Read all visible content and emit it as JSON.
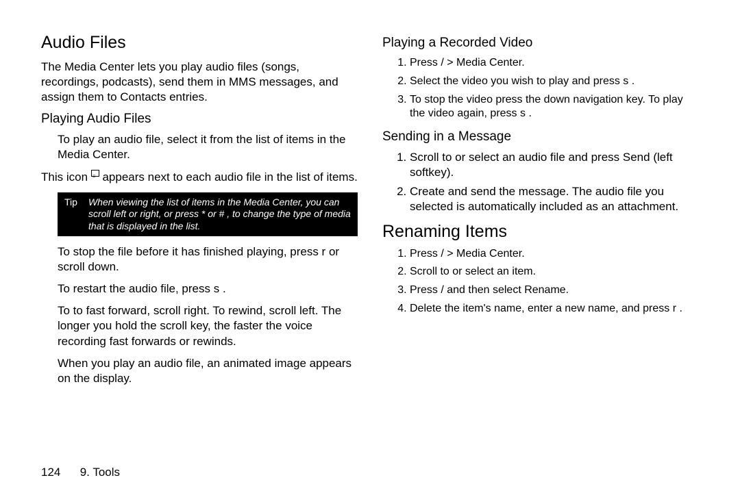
{
  "left": {
    "h1": "Audio Files",
    "intro": "The Media Center lets you play audio files (songs, recordings, podcasts), send them in MMS messages, and assign them to Contacts entries.",
    "h2": "Playing Audio Files",
    "p1": "To play an audio file, select it from the list of items in the Media Center.",
    "p2a": "This icon ",
    "p2b": " appears next to each audio file in the list of items.",
    "tip_label": "Tip",
    "tip_text": "When viewing the list of items in the Media Center, you can scroll left or right, or press *    or #   , to change the type of media that is displayed in the list.",
    "p3": "To stop the file before it has finished playing, press r    or scroll down.",
    "p4": "To restart the audio file, press s  .",
    "p5": "To to fast forward, scroll right. To rewind, scroll left. The longer you hold the scroll key, the faster the voice recording fast forwards or rewinds.",
    "p6": "When you play an audio file, an animated image appears on the display."
  },
  "right": {
    "h2a": "Playing a Recorded Video",
    "a1": "Press /     > Media Center.",
    "a2": "Select the video you wish to play and press s  .",
    "a3": "To stop the video press the down navigation key. To play the video again, press s  .",
    "h2b": "Sending in a Message",
    "b1": "Scroll to or select an audio file and press Send (left softkey).",
    "b2": "Create and send the message. The audio file you selected is automatically included as an attachment.",
    "h3": "Renaming Items",
    "c1": "Press /     > Media Center.",
    "c2": "Scroll to or select an item.",
    "c3": "Press /    and then select Rename.",
    "c4": "Delete the item's name, enter a new name, and press r  ."
  },
  "footer": {
    "page": "124",
    "section": "9. Tools"
  }
}
